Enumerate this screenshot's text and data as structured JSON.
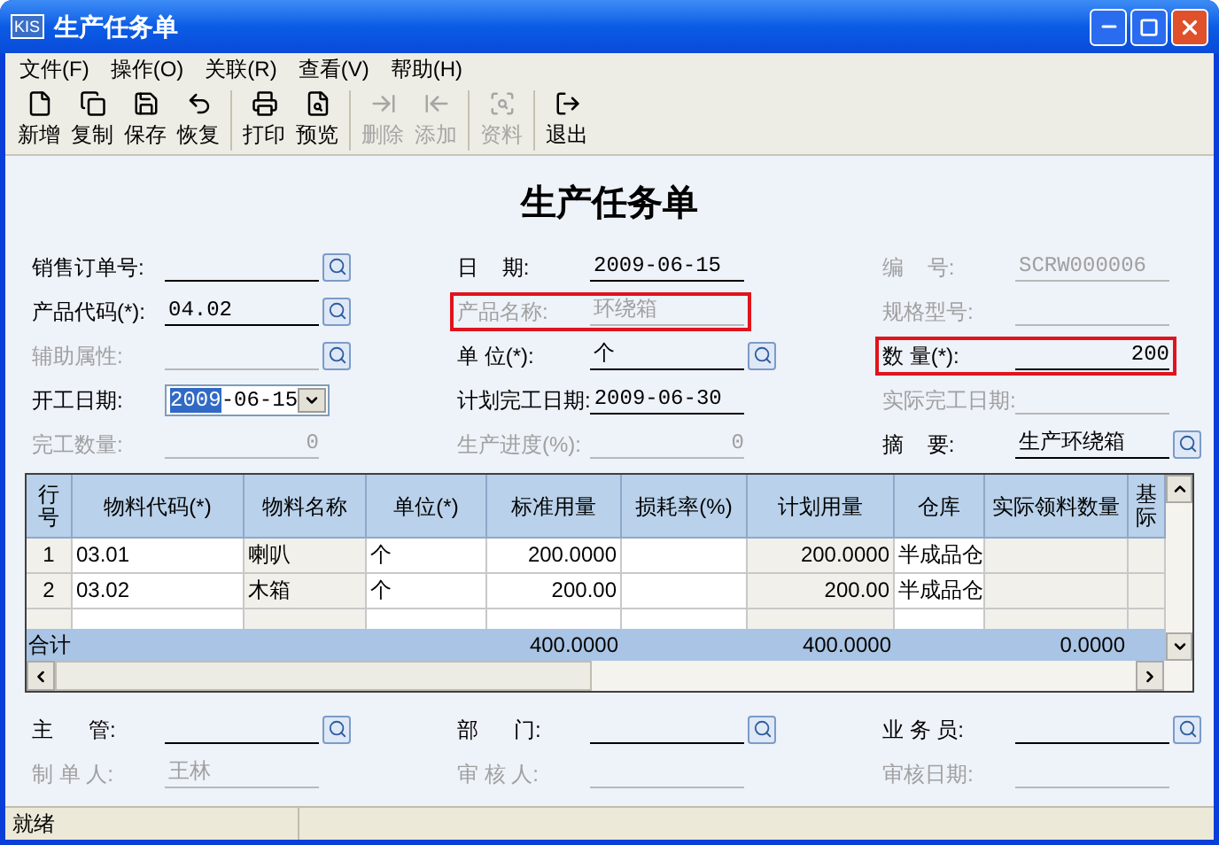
{
  "window": {
    "app_badge": "KIS",
    "title": "生产任务单"
  },
  "menu": [
    "文件(F)",
    "操作(O)",
    "关联(R)",
    "查看(V)",
    "帮助(H)"
  ],
  "toolbar": [
    [
      {
        "kind": "new",
        "label": "新增",
        "disabled": false
      },
      {
        "kind": "copy",
        "label": "复制",
        "disabled": false
      },
      {
        "kind": "save",
        "label": "保存",
        "disabled": false
      },
      {
        "kind": "undo",
        "label": "恢复",
        "disabled": false
      }
    ],
    [
      {
        "kind": "print",
        "label": "打印",
        "disabled": false
      },
      {
        "kind": "preview",
        "label": "预览",
        "disabled": false
      }
    ],
    [
      {
        "kind": "delete",
        "label": "删除",
        "disabled": true
      },
      {
        "kind": "add",
        "label": "添加",
        "disabled": true
      }
    ],
    [
      {
        "kind": "info",
        "label": "资料",
        "disabled": true
      }
    ],
    [
      {
        "kind": "exit",
        "label": "退出",
        "disabled": false
      }
    ]
  ],
  "form_title": "生产任务单",
  "fields": [
    {
      "label": "销售订单号:",
      "kind": "lookup",
      "disabled": false,
      "highlighted": false
    },
    {
      "label": "日    期:",
      "value": "2009-06-15",
      "kind": "text",
      "disabled": false,
      "highlighted": false
    },
    {
      "label": "编    号:",
      "value": "SCRW000006",
      "kind": "text",
      "disabled": true,
      "highlighted": false
    },
    {
      "label": "产品代码(*):",
      "value": "04.02",
      "kind": "lookup",
      "disabled": false,
      "highlighted": false
    },
    {
      "label": "产品名称:",
      "value": "环绕箱",
      "kind": "text",
      "disabled": true,
      "highlighted": true
    },
    {
      "label": "规格型号:",
      "kind": "text",
      "disabled": true,
      "highlighted": false
    },
    {
      "label": "辅助属性:",
      "kind": "lookup",
      "disabled": true,
      "highlighted": false
    },
    {
      "label": "单 位(*):",
      "value": "个",
      "kind": "lookup",
      "disabled": false,
      "highlighted": false
    },
    {
      "label": "数 量(*):",
      "value": "200",
      "kind": "number",
      "disabled": false,
      "highlighted": true
    },
    {
      "label": "开工日期:",
      "value_parts": [
        {
          "text": "2009",
          "selected": true
        },
        {
          "text": "-06-15",
          "selected": false
        }
      ],
      "kind": "date",
      "disabled": false,
      "highlighted": false
    },
    {
      "label": "计划完工日期:",
      "value": "2009-06-30",
      "kind": "text",
      "disabled": false,
      "highlighted": false
    },
    {
      "label": "实际完工日期:",
      "kind": "text",
      "disabled": true,
      "highlighted": false
    },
    {
      "label": "完工数量:",
      "value": "0",
      "kind": "number",
      "disabled": true,
      "highlighted": false
    },
    {
      "label": "生产进度(%):",
      "value": "0",
      "kind": "number",
      "disabled": true,
      "highlighted": false
    },
    {
      "label": "摘    要:",
      "value": "生产环绕箱",
      "kind": "lookup",
      "disabled": false,
      "highlighted": false
    }
  ],
  "table": {
    "columns": [
      {
        "label": "行号",
        "editable": false,
        "kind": "text"
      },
      {
        "label": "物料代码(*)",
        "editable": true,
        "kind": "text"
      },
      {
        "label": "物料名称",
        "editable": false,
        "kind": "text"
      },
      {
        "label": "单位(*)",
        "editable": true,
        "kind": "text"
      },
      {
        "label": "标准用量",
        "editable": true,
        "kind": "number",
        "total": "400.0000"
      },
      {
        "label": "损耗率(%)",
        "editable": true,
        "kind": "number"
      },
      {
        "label": "计划用量",
        "editable": false,
        "kind": "number",
        "total": "400.0000"
      },
      {
        "label": "仓库",
        "editable": true,
        "kind": "text"
      },
      {
        "label": "实际领料数量",
        "editable": false,
        "kind": "number",
        "total": "0.0000"
      },
      {
        "label": "基际",
        "editable": false,
        "kind": "text"
      }
    ],
    "rows": [
      [
        "1",
        "03.01",
        "喇叭",
        "个",
        "200.0000",
        null,
        "200.0000",
        "半成品仓",
        null,
        null
      ],
      [
        "2",
        "03.02",
        "木箱",
        "个",
        "200.00",
        null,
        "200.00",
        "半成品仓",
        null,
        null
      ]
    ],
    "total_label": "合计"
  },
  "footer_fields": [
    {
      "label": "主      管:",
      "kind": "lookup",
      "disabled": false
    },
    {
      "label": "部      门:",
      "kind": "lookup",
      "disabled": false
    },
    {
      "label": "业 务 员:",
      "kind": "lookup",
      "disabled": false
    },
    {
      "label": "制 单 人:",
      "value": "王林",
      "kind": "text",
      "disabled": true
    },
    {
      "label": "审 核 人:",
      "kind": "text",
      "disabled": true
    },
    {
      "label": "审核日期:",
      "kind": "text",
      "disabled": true
    }
  ],
  "status_bar": [
    "就绪"
  ]
}
